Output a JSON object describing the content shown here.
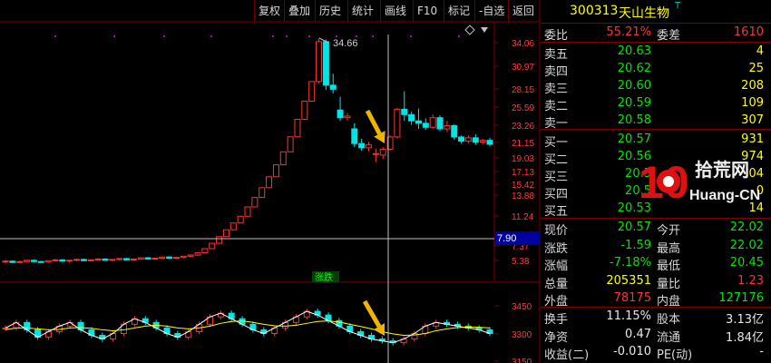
{
  "toolbar": {
    "buttons": [
      "复权",
      "叠加",
      "历史",
      "统计",
      "画线",
      "F10",
      "标记",
      "-自选",
      "返回"
    ]
  },
  "stock": {
    "code": "300313",
    "name": "天山生物",
    "marker": "T"
  },
  "order_book": {
    "weibi_label": "委比",
    "weibi": "55.21%",
    "weicha_label": "委差",
    "weicha": "1610",
    "asks": [
      {
        "label": "卖五",
        "price": "20.63",
        "volume": "4"
      },
      {
        "label": "卖四",
        "price": "20.62",
        "volume": "25"
      },
      {
        "label": "卖三",
        "price": "20.60",
        "volume": "208"
      },
      {
        "label": "卖二",
        "price": "20.59",
        "volume": "109"
      },
      {
        "label": "卖一",
        "price": "20.58",
        "volume": "307"
      }
    ],
    "bids": [
      {
        "label": "买一",
        "price": "20.57",
        "volume": "931"
      },
      {
        "label": "买二",
        "price": "20.56",
        "volume": "974"
      },
      {
        "label": "买三",
        "price": "20.5",
        "volume": "04"
      },
      {
        "label": "买四",
        "price": "20.5",
        "volume": "0"
      },
      {
        "label": "买五",
        "price": "20.53",
        "volume": "14"
      }
    ]
  },
  "quote": [
    {
      "l1": "现价",
      "v1": "20.57",
      "c1": "grn",
      "l2": "今开",
      "v2": "22.02",
      "c2": "grn"
    },
    {
      "l1": "涨跌",
      "v1": "-1.59",
      "c1": "grn",
      "l2": "最高",
      "v2": "22.02",
      "c2": "grn"
    },
    {
      "l1": "涨幅",
      "v1": "-7.18%",
      "c1": "grn",
      "l2": "最低",
      "v2": "20.45",
      "c2": "grn"
    },
    {
      "l1": "总量",
      "v1": "205351",
      "c1": "yel",
      "l2": "量比",
      "v2": "1.23",
      "c2": "red"
    },
    {
      "l1": "外盘",
      "v1": "78175",
      "c1": "red",
      "l2": "内盘",
      "v2": "127176",
      "c2": "grn"
    }
  ],
  "stats": [
    {
      "l1": "换手",
      "v1": "11.15%",
      "l2": "股本",
      "v2": "3.13亿"
    },
    {
      "l1": "净资",
      "v1": "0.47",
      "l2": "流通",
      "v2": "1.84亿"
    },
    {
      "l1": "收益(二)",
      "v1": "-0.010",
      "l2": "PE(动)",
      "v2": "-"
    }
  ],
  "watermark": {
    "big": "10",
    "cn": "拾荒网",
    "en": "Huang-CN"
  },
  "colors": {
    "up": "#ff3232",
    "down": "#00e6e6",
    "ma": "#ffff00",
    "ma2": "#ffffff",
    "axis": "#800000",
    "arrow": "#f0b400",
    "highlight_bg": "#0000a0"
  },
  "chart_data": [
    {
      "type": "candlestick",
      "y_tick_labels": [
        "34.06",
        "30.97",
        "28.15",
        "25.59",
        "23.26",
        "21.15",
        "19.03",
        "17.13",
        "15.42",
        "13.88",
        "11.24",
        "7.37",
        "5.38"
      ],
      "y_ticks": [
        34.06,
        30.97,
        28.15,
        25.59,
        23.26,
        21.15,
        19.03,
        17.13,
        15.42,
        13.88,
        11.24,
        7.37,
        5.38
      ],
      "crosshair_value": "7.90",
      "max_annotation": "34.66",
      "label": "涨跌",
      "candles": [
        {
          "o": 5.2,
          "h": 5.45,
          "l": 5.05,
          "c": 5.3
        },
        {
          "o": 5.3,
          "h": 5.4,
          "l": 5.1,
          "c": 5.15
        },
        {
          "o": 5.15,
          "h": 5.35,
          "l": 5.05,
          "c": 5.25
        },
        {
          "o": 5.25,
          "h": 5.45,
          "l": 5.15,
          "c": 5.4
        },
        {
          "o": 5.4,
          "h": 5.5,
          "l": 5.2,
          "c": 5.25
        },
        {
          "o": 5.25,
          "h": 5.35,
          "l": 5.1,
          "c": 5.2
        },
        {
          "o": 5.2,
          "h": 5.4,
          "l": 5.1,
          "c": 5.35
        },
        {
          "o": 5.35,
          "h": 5.55,
          "l": 5.25,
          "c": 5.45
        },
        {
          "o": 5.45,
          "h": 5.55,
          "l": 5.2,
          "c": 5.3
        },
        {
          "o": 5.3,
          "h": 5.45,
          "l": 5.15,
          "c": 5.4
        },
        {
          "o": 5.4,
          "h": 5.6,
          "l": 5.3,
          "c": 5.5
        },
        {
          "o": 5.5,
          "h": 5.6,
          "l": 5.3,
          "c": 5.35
        },
        {
          "o": 5.35,
          "h": 5.5,
          "l": 5.25,
          "c": 5.45
        },
        {
          "o": 5.45,
          "h": 5.65,
          "l": 5.35,
          "c": 5.55
        },
        {
          "o": 5.55,
          "h": 5.65,
          "l": 5.35,
          "c": 5.4
        },
        {
          "o": 5.4,
          "h": 5.55,
          "l": 5.3,
          "c": 5.5
        },
        {
          "o": 5.5,
          "h": 5.7,
          "l": 5.4,
          "c": 5.6
        },
        {
          "o": 5.6,
          "h": 5.7,
          "l": 5.4,
          "c": 5.45
        },
        {
          "o": 5.45,
          "h": 5.6,
          "l": 5.35,
          "c": 5.55
        },
        {
          "o": 5.55,
          "h": 5.75,
          "l": 5.45,
          "c": 5.7
        },
        {
          "o": 5.7,
          "h": 5.8,
          "l": 5.5,
          "c": 5.55
        },
        {
          "o": 5.55,
          "h": 5.7,
          "l": 5.45,
          "c": 5.65
        },
        {
          "o": 5.65,
          "h": 5.85,
          "l": 5.55,
          "c": 5.8
        },
        {
          "o": 5.8,
          "h": 5.9,
          "l": 5.6,
          "c": 5.65
        },
        {
          "o": 5.65,
          "h": 5.8,
          "l": 5.55,
          "c": 5.75
        },
        {
          "o": 5.75,
          "h": 5.95,
          "l": 5.65,
          "c": 5.9
        },
        {
          "o": 5.9,
          "h": 6.1,
          "l": 5.8,
          "c": 6.05
        },
        {
          "o": 6.05,
          "h": 6.4,
          "l": 5.95,
          "c": 6.35
        },
        {
          "o": 6.35,
          "h": 6.95,
          "l": 6.3,
          "c": 6.95
        },
        {
          "o": 6.95,
          "h": 7.65,
          "l": 6.9,
          "c": 7.65
        },
        {
          "o": 7.65,
          "h": 8.4,
          "l": 7.6,
          "c": 8.4
        },
        {
          "o": 8.4,
          "h": 9.25,
          "l": 8.35,
          "c": 9.25
        },
        {
          "o": 9.25,
          "h": 10.18,
          "l": 9.2,
          "c": 10.18
        },
        {
          "o": 10.18,
          "h": 11.2,
          "l": 10.1,
          "c": 11.2
        },
        {
          "o": 11.2,
          "h": 12.32,
          "l": 11.15,
          "c": 12.32
        },
        {
          "o": 12.32,
          "h": 13.55,
          "l": 12.3,
          "c": 13.55
        },
        {
          "o": 13.55,
          "h": 14.91,
          "l": 13.5,
          "c": 14.91
        },
        {
          "o": 14.91,
          "h": 16.4,
          "l": 14.85,
          "c": 16.4
        },
        {
          "o": 16.4,
          "h": 18.04,
          "l": 16.35,
          "c": 18.04
        },
        {
          "o": 18.04,
          "h": 19.84,
          "l": 18.0,
          "c": 19.84
        },
        {
          "o": 19.84,
          "h": 21.82,
          "l": 19.8,
          "c": 21.82
        },
        {
          "o": 21.82,
          "h": 24.0,
          "l": 21.7,
          "c": 24.0
        },
        {
          "o": 24.0,
          "h": 26.4,
          "l": 23.9,
          "c": 26.4
        },
        {
          "o": 26.4,
          "h": 29.04,
          "l": 26.3,
          "c": 29.04
        },
        {
          "o": 29.04,
          "h": 34.66,
          "l": 28.8,
          "c": 34.2
        },
        {
          "o": 34.2,
          "h": 34.5,
          "l": 28.0,
          "c": 28.6
        },
        {
          "o": 28.6,
          "h": 30.0,
          "l": 27.5,
          "c": 28.1
        },
        {
          "o": 25.2,
          "h": 27.0,
          "l": 23.8,
          "c": 24.2
        },
        {
          "o": 24.2,
          "h": 24.8,
          "l": 23.8,
          "c": 24.4
        },
        {
          "o": 22.8,
          "h": 23.5,
          "l": 20.5,
          "c": 21.0
        },
        {
          "o": 21.0,
          "h": 21.6,
          "l": 20.0,
          "c": 20.4
        },
        {
          "o": 20.4,
          "h": 21.2,
          "l": 19.9,
          "c": 20.8
        },
        {
          "o": 19.6,
          "h": 20.3,
          "l": 18.4,
          "c": 19.6
        },
        {
          "o": 19.4,
          "h": 20.5,
          "l": 18.9,
          "c": 20.2
        },
        {
          "o": 20.2,
          "h": 22.0,
          "l": 20.0,
          "c": 21.8
        },
        {
          "o": 21.8,
          "h": 25.5,
          "l": 21.6,
          "c": 25.3
        },
        {
          "o": 25.3,
          "h": 27.8,
          "l": 23.8,
          "c": 24.6
        },
        {
          "o": 24.6,
          "h": 25.0,
          "l": 23.3,
          "c": 23.8
        },
        {
          "o": 23.8,
          "h": 25.4,
          "l": 22.8,
          "c": 23.5
        },
        {
          "o": 23.5,
          "h": 24.1,
          "l": 22.7,
          "c": 23.0
        },
        {
          "o": 23.0,
          "h": 24.6,
          "l": 22.8,
          "c": 24.2
        },
        {
          "o": 24.2,
          "h": 24.5,
          "l": 22.5,
          "c": 22.8
        },
        {
          "o": 22.8,
          "h": 23.8,
          "l": 22.4,
          "c": 23.2
        },
        {
          "o": 23.2,
          "h": 23.4,
          "l": 21.5,
          "c": 21.8
        },
        {
          "o": 21.8,
          "h": 22.0,
          "l": 21.0,
          "c": 21.3
        },
        {
          "o": 21.3,
          "h": 22.0,
          "l": 21.0,
          "c": 21.7
        },
        {
          "o": 21.7,
          "h": 22.1,
          "l": 20.8,
          "c": 21.2
        },
        {
          "o": 21.2,
          "h": 21.6,
          "l": 20.9,
          "c": 21.4
        },
        {
          "o": 21.4,
          "h": 21.7,
          "l": 20.6,
          "c": 20.9
        }
      ]
    },
    {
      "type": "line",
      "y_tick_labels": [
        "3450",
        "3300",
        "3150"
      ],
      "y_ticks": [
        3450,
        3300,
        3150
      ],
      "series": [
        {
          "name": "",
          "values": [
            3330,
            3360,
            3320,
            3280,
            3310,
            3340,
            3360,
            3320,
            3290,
            3270,
            3300,
            3350,
            3380,
            3360,
            3330,
            3300,
            3280,
            3310,
            3350,
            3390,
            3410,
            3380,
            3350,
            3320,
            3300,
            3330,
            3360,
            3390,
            3420,
            3400,
            3370,
            3340,
            3310,
            3290,
            3270,
            3260,
            3250,
            3270,
            3300,
            3340,
            3360,
            3350,
            3340,
            3330,
            3320,
            3300
          ]
        },
        {
          "name": "",
          "values": [
            3320,
            3330,
            3330,
            3325,
            3320,
            3322,
            3330,
            3332,
            3328,
            3320,
            3315,
            3320,
            3330,
            3340,
            3345,
            3340,
            3330,
            3325,
            3330,
            3340,
            3355,
            3365,
            3368,
            3360,
            3350,
            3342,
            3340,
            3345,
            3355,
            3365,
            3368,
            3362,
            3350,
            3338,
            3325,
            3310,
            3298,
            3290,
            3292,
            3300,
            3315,
            3325,
            3332,
            3335,
            3334,
            3330
          ]
        }
      ]
    }
  ]
}
